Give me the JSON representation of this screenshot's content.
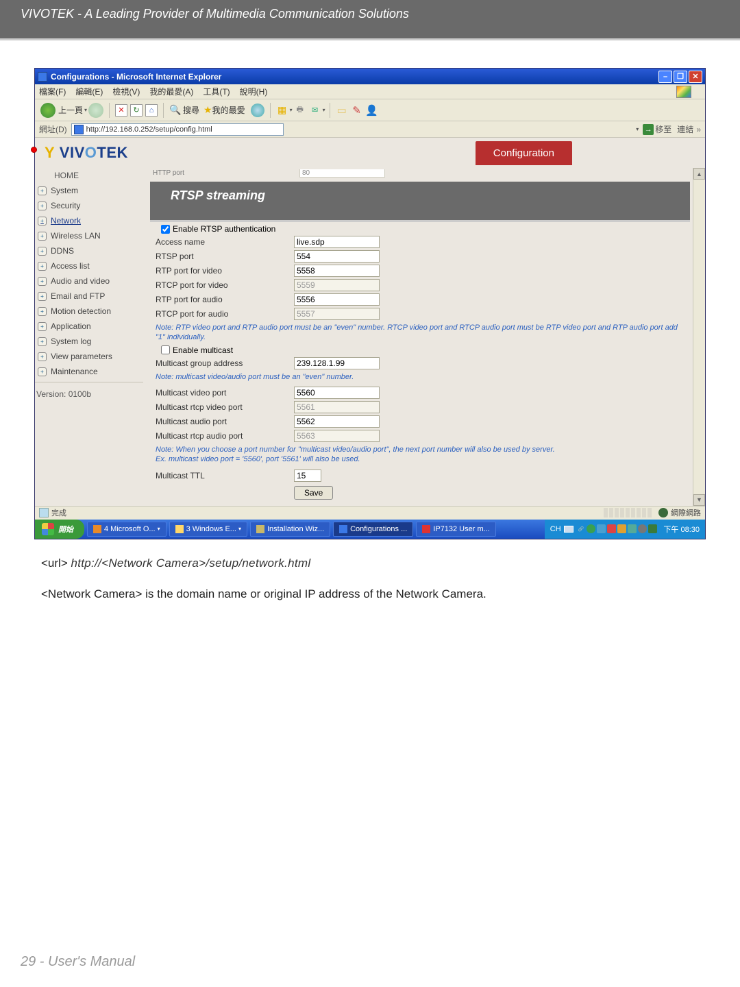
{
  "header": "VIVOTEK - A Leading Provider of Multimedia Communication Solutions",
  "window_title": "Configurations - Microsoft Internet Explorer",
  "menubar": [
    "檔案(F)",
    "編輯(E)",
    "檢視(V)",
    "我的最愛(A)",
    "工具(T)",
    "說明(H)"
  ],
  "toolbar_back": "上一頁",
  "toolbar_search": "搜尋",
  "toolbar_fav": "我的最愛",
  "addr_label": "網址(D)",
  "address": "http://192.168.0.252/setup/config.html",
  "go_label": "移至",
  "links_label": "連結",
  "brand": "VIVOTEK",
  "config_tab": "Configuration",
  "http_port_label": "HTTP port",
  "http_port_value": "80",
  "sidebar": {
    "home": "HOME",
    "items": [
      "System",
      "Security",
      "Network",
      "Wireless LAN",
      "DDNS",
      "Access list",
      "Audio and video",
      "Email and FTP",
      "Motion detection",
      "Application",
      "System log",
      "View parameters",
      "Maintenance"
    ],
    "selected_index": 2,
    "version": "Version: 0100b"
  },
  "rtsp": {
    "title": "RTSP streaming",
    "enable_auth": "Enable RTSP authentication",
    "rows": [
      {
        "label": "Access name",
        "value": "live.sdp",
        "disabled": false
      },
      {
        "label": "RTSP port",
        "value": "554",
        "disabled": false
      },
      {
        "label": "RTP port for video",
        "value": "5558",
        "disabled": false
      },
      {
        "label": "RTCP port for video",
        "value": "5559",
        "disabled": true
      },
      {
        "label": "RTP port for audio",
        "value": "5556",
        "disabled": false
      },
      {
        "label": "RTCP port for audio",
        "value": "5557",
        "disabled": true
      }
    ],
    "note1": "Note: RTP video port and RTP audio port must be an \"even\" number. RTCP video port and RTCP audio port must be RTP video port and RTP audio port add \"1\" individually.",
    "enable_multicast": "Enable multicast",
    "multicast_addr_label": "Multicast group address",
    "multicast_addr_value": "239.128.1.99",
    "note2": "Note: multicast video/audio port must be an \"even\" number.",
    "mrows": [
      {
        "label": "Multicast video port",
        "value": "5560",
        "disabled": false
      },
      {
        "label": "Multicast rtcp video port",
        "value": "5561",
        "disabled": true
      },
      {
        "label": "Multicast audio port",
        "value": "5562",
        "disabled": false
      },
      {
        "label": "Multicast rtcp audio port",
        "value": "5563",
        "disabled": true
      }
    ],
    "note3": "Note: When you choose a port number for \"multicast video/audio port\", the next port number will also be used by server.\nEx. multicast video port = '5560', port '5561' will also be used.",
    "ttl_label": "Multicast TTL",
    "ttl_value": "15",
    "save": "Save"
  },
  "status_done": "完成",
  "status_zone": "網際網路",
  "start": "開始",
  "task_items": [
    "4 Microsoft O...",
    "3 Windows E...",
    "Installation Wiz...",
    "Configurations ...",
    "IP7132 User m..."
  ],
  "tray_lang": "CH",
  "tray_time": "下午 08:30",
  "caption1_pre": "<url> ",
  "caption1_url": "http://<Network Camera>/setup/network.html",
  "caption2": "<Network Camera> is the domain name or original IP address of the Network Camera.",
  "footer": "29 - User's Manual"
}
